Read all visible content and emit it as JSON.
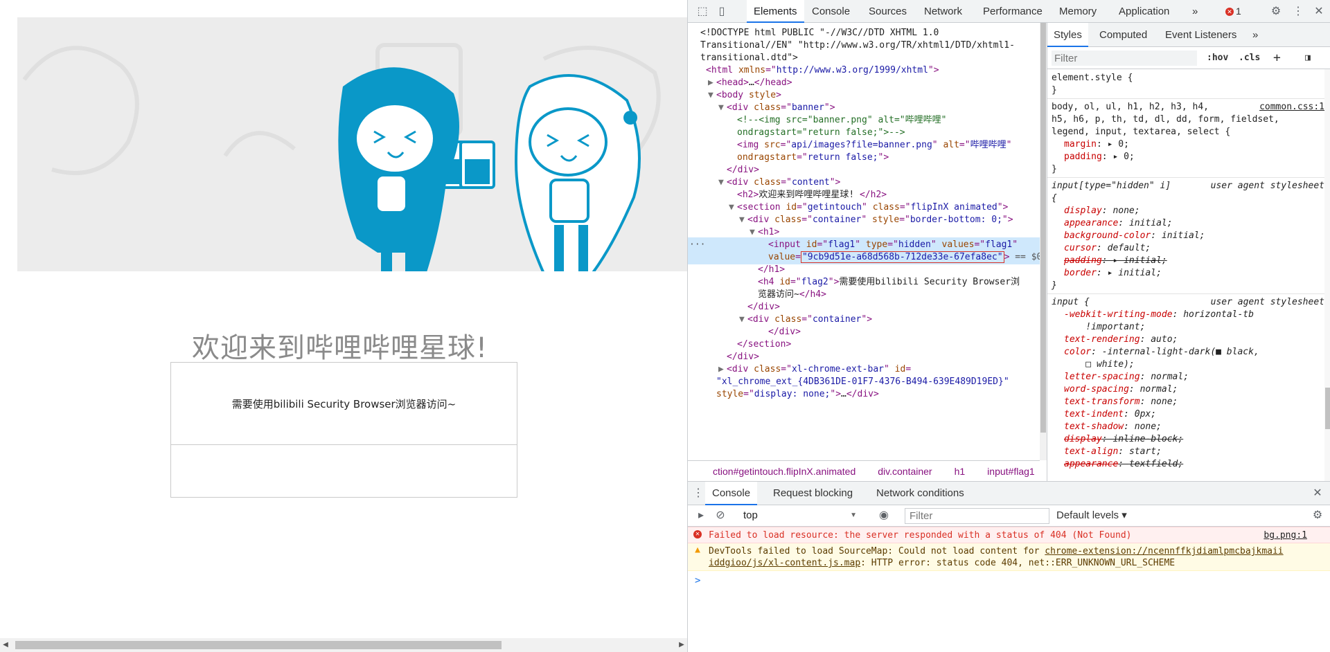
{
  "page": {
    "heading": "欢迎来到哔哩哔哩星球!",
    "message": "需要使用bilibili Security Browser浏览器访问~"
  },
  "devtools": {
    "tabs": [
      "Elements",
      "Console",
      "Sources",
      "Network",
      "Performance",
      "Memory",
      "Application"
    ],
    "more_tabs": "»",
    "error_count": "1",
    "elements": {
      "lines": [
        {
          "id": "l1",
          "parts": [
            [
              "tx",
              "<!DOCTYPE html PUBLIC \"-//W3C//DTD XHTML 1.0"
            ]
          ]
        },
        {
          "id": "l2",
          "parts": [
            [
              "tx",
              "Transitional//EN\" \"http://www.w3.org/TR/xhtml1/DTD/xhtml1-"
            ]
          ]
        },
        {
          "id": "l3",
          "parts": [
            [
              "tx",
              "transitional.dtd\">"
            ]
          ]
        },
        {
          "id": "l4",
          "parts": [
            [
              "tag",
              "<html "
            ],
            [
              "an",
              "xmlns"
            ],
            [
              "tag",
              "=\""
            ],
            [
              "av",
              "http://www.w3.org/1999/xhtml"
            ],
            [
              "tag",
              "\">"
            ]
          ]
        },
        {
          "id": "l5",
          "parts": [
            [
              "tag",
              "<head>"
            ],
            [
              "tx",
              "…"
            ],
            [
              "tag",
              "</head>"
            ]
          ]
        },
        {
          "id": "l6",
          "parts": [
            [
              "tag",
              "<body "
            ],
            [
              "an",
              "style"
            ],
            [
              "tag",
              ">"
            ]
          ]
        },
        {
          "id": "l7",
          "parts": [
            [
              "tag",
              "<div "
            ],
            [
              "an",
              "class"
            ],
            [
              "tag",
              "=\""
            ],
            [
              "av",
              "banner"
            ],
            [
              "tag",
              "\">"
            ]
          ]
        },
        {
          "id": "l8",
          "parts": [
            [
              "cm",
              "<!--<img src=\"banner.png\" alt=\"哔哩哔哩\""
            ]
          ]
        },
        {
          "id": "l9",
          "parts": [
            [
              "cm",
              "ondragstart=\"return false;\">-->"
            ]
          ]
        },
        {
          "id": "l10",
          "parts": [
            [
              "tag",
              "<img "
            ],
            [
              "an",
              "src"
            ],
            [
              "tag",
              "=\""
            ],
            [
              "av",
              "api/images?file=banner.png"
            ],
            [
              "tag",
              "\" "
            ],
            [
              "an",
              "alt"
            ],
            [
              "tag",
              "=\""
            ],
            [
              "av",
              "哔哩哔哩"
            ],
            [
              "tag",
              "\""
            ]
          ]
        },
        {
          "id": "l11",
          "parts": [
            [
              "an",
              "ondragstart"
            ],
            [
              "tag",
              "=\""
            ],
            [
              "av",
              "return false;"
            ],
            [
              "tag",
              "\">"
            ]
          ]
        },
        {
          "id": "l12",
          "parts": [
            [
              "tag",
              "</div>"
            ]
          ]
        },
        {
          "id": "l13",
          "parts": [
            [
              "tag",
              "<div "
            ],
            [
              "an",
              "class"
            ],
            [
              "tag",
              "=\""
            ],
            [
              "av",
              "content"
            ],
            [
              "tag",
              "\">"
            ]
          ]
        },
        {
          "id": "l14",
          "parts": [
            [
              "tag",
              "<h2>"
            ],
            [
              "tx",
              "欢迎来到哔哩哔哩星球! "
            ],
            [
              "tag",
              "</h2>"
            ]
          ]
        },
        {
          "id": "l15",
          "parts": [
            [
              "tag",
              "<section "
            ],
            [
              "an",
              "id"
            ],
            [
              "tag",
              "=\""
            ],
            [
              "av",
              "getintouch"
            ],
            [
              "tag",
              "\" "
            ],
            [
              "an",
              "class"
            ],
            [
              "tag",
              "=\""
            ],
            [
              "av",
              "flipInX animated"
            ],
            [
              "tag",
              "\">"
            ]
          ]
        },
        {
          "id": "l16",
          "parts": [
            [
              "tag",
              "<div "
            ],
            [
              "an",
              "class"
            ],
            [
              "tag",
              "=\""
            ],
            [
              "av",
              "container"
            ],
            [
              "tag",
              "\" "
            ],
            [
              "an",
              "style"
            ],
            [
              "tag",
              "=\""
            ],
            [
              "av",
              "border-bottom: 0;"
            ],
            [
              "tag",
              "\">"
            ]
          ]
        },
        {
          "id": "l17",
          "parts": [
            [
              "tag",
              "<h1>"
            ]
          ]
        },
        {
          "id": "l18",
          "parts": [
            [
              "tag",
              "<input "
            ],
            [
              "an",
              "id"
            ],
            [
              "tag",
              "=\""
            ],
            [
              "av",
              "flag1"
            ],
            [
              "tag",
              "\" "
            ],
            [
              "an",
              "type"
            ],
            [
              "tag",
              "=\""
            ],
            [
              "av",
              "hidden"
            ],
            [
              "tag",
              "\" "
            ],
            [
              "an",
              "values"
            ],
            [
              "tag",
              "=\""
            ],
            [
              "av",
              "flag1"
            ],
            [
              "tag",
              "\""
            ]
          ]
        },
        {
          "id": "l19",
          "parts": [
            [
              "an",
              "value"
            ],
            [
              "tag",
              "="
            ]
          ]
        },
        {
          "id": "l20",
          "parts": [
            [
              "tag",
              "</h1>"
            ]
          ]
        },
        {
          "id": "l21",
          "parts": [
            [
              "tag",
              "<h4 "
            ],
            [
              "an",
              "id"
            ],
            [
              "tag",
              "=\""
            ],
            [
              "av",
              "flag2"
            ],
            [
              "tag",
              "\">"
            ],
            [
              "tx",
              "需要使用bilibili Security Browser浏"
            ]
          ]
        },
        {
          "id": "l22",
          "parts": [
            [
              "tx",
              "览器访问~"
            ],
            [
              "tag",
              "</h4>"
            ]
          ]
        },
        {
          "id": "l23",
          "parts": [
            [
              "tag",
              "</div>"
            ]
          ]
        },
        {
          "id": "l24",
          "parts": [
            [
              "tag",
              "<div "
            ],
            [
              "an",
              "class"
            ],
            [
              "tag",
              "=\""
            ],
            [
              "av",
              "container"
            ],
            [
              "tag",
              "\">"
            ]
          ]
        },
        {
          "id": "l25",
          "parts": [
            [
              "tag",
              "</div>"
            ]
          ]
        },
        {
          "id": "l26",
          "parts": [
            [
              "tag",
              "</section>"
            ]
          ]
        },
        {
          "id": "l27",
          "parts": [
            [
              "tag",
              "</div>"
            ]
          ]
        },
        {
          "id": "l28",
          "parts": [
            [
              "tag",
              "<div "
            ],
            [
              "an",
              "class"
            ],
            [
              "tag",
              "=\""
            ],
            [
              "av",
              "xl-chrome-ext-bar"
            ],
            [
              "tag",
              "\" "
            ],
            [
              "an",
              "id"
            ],
            [
              "tag",
              "="
            ]
          ]
        },
        {
          "id": "l29",
          "parts": [
            [
              "av",
              "\"xl_chrome_ext_{4DB361DE-01F7-4376-B494-639E489D19ED}\""
            ]
          ]
        },
        {
          "id": "l30",
          "parts": [
            [
              "an",
              "style"
            ],
            [
              "tag",
              "=\""
            ],
            [
              "av",
              "display: none;"
            ],
            [
              "tag",
              "\">"
            ],
            [
              "tx",
              "…"
            ],
            [
              "tag",
              "</div>"
            ]
          ]
        }
      ],
      "flag_value": "\"9cb9d51e-a68d568b-712de33e-67efa8ec\"",
      "selected_suffix": " == $0",
      "dots": "···",
      "breadcrumb": [
        "ction#getintouch.flipInX.animated",
        "div.container",
        "h1",
        "input#flag1"
      ],
      "breadcrumb_more": "···"
    },
    "styles": {
      "tabs": [
        "Styles",
        "Computed",
        "Event Listeners"
      ],
      "more": "»",
      "filter_placeholder": "Filter",
      "hov": ":hov",
      "cls": ".cls",
      "plus": "+",
      "rules": [
        {
          "id": "r0",
          "text": "element.style {"
        },
        {
          "id": "r0e",
          "text": "}"
        },
        {
          "id": "r1a",
          "text": "body, ol, ul, h1, h2, h3, h4,",
          "src": "common.css:1"
        },
        {
          "id": "r1b",
          "text": "h5, h6, p, th, td, dl, dd, form, fieldset,"
        },
        {
          "id": "r1c",
          "text": "legend, input, textarea, select {"
        },
        {
          "id": "r1d",
          "prop": "margin",
          "val": "▸ 0;"
        },
        {
          "id": "r1e",
          "prop": "padding",
          "val": "▸ 0;"
        },
        {
          "id": "r1f",
          "text": "}"
        },
        {
          "id": "r2a",
          "text": "input[type=\"hidden\" i]",
          "src": "user agent stylesheet"
        },
        {
          "id": "r2b",
          "text": "{"
        },
        {
          "id": "r2c",
          "prop": "display",
          "val": "none;"
        },
        {
          "id": "r2d",
          "prop": "appearance",
          "val": "initial;"
        },
        {
          "id": "r2e",
          "prop": "background-color",
          "val": "initial;"
        },
        {
          "id": "r2f",
          "prop": "cursor",
          "val": "default;"
        },
        {
          "id": "r2g",
          "prop": "padding",
          "val": "▸ initial;",
          "strike": true
        },
        {
          "id": "r2h",
          "prop": "border",
          "val": "▸ initial;"
        },
        {
          "id": "r2i",
          "text": "}"
        },
        {
          "id": "r3a",
          "text": "input {",
          "src": "user agent stylesheet"
        },
        {
          "id": "r3b",
          "prop": "-webkit-writing-mode",
          "val": "horizontal-tb"
        },
        {
          "id": "r3c",
          "text": "    !important;"
        },
        {
          "id": "r3d",
          "prop": "text-rendering",
          "val": "auto;"
        },
        {
          "id": "r3e",
          "prop": "color",
          "val": "-internal-light-dark(■ black,"
        },
        {
          "id": "r3f",
          "text": "    □ white);"
        },
        {
          "id": "r3g",
          "prop": "letter-spacing",
          "val": "normal;"
        },
        {
          "id": "r3h",
          "prop": "word-spacing",
          "val": "normal;"
        },
        {
          "id": "r3i",
          "prop": "text-transform",
          "val": "none;"
        },
        {
          "id": "r3j",
          "prop": "text-indent",
          "val": "0px;"
        },
        {
          "id": "r3k",
          "prop": "text-shadow",
          "val": "none;"
        },
        {
          "id": "r3l",
          "prop": "display",
          "val": "inline-block;",
          "strike": true
        },
        {
          "id": "r3m",
          "prop": "text-align",
          "val": "start;"
        },
        {
          "id": "r3n",
          "prop": "appearance",
          "val": "textfield;",
          "strike": true
        }
      ]
    },
    "drawer": {
      "tabs": [
        "Console",
        "Request blocking",
        "Network conditions"
      ],
      "context": "top",
      "filter_placeholder": "Filter",
      "levels": "Default levels ▾",
      "error_msg": "Failed to load resource: the server responded with a status of 404 (Not Found)",
      "error_src": "bg.png:1",
      "warn_line1_a": "DevTools failed to load SourceMap: Could not load content for ",
      "warn_line1_b": "chrome-extension://ncennffkjdiamlpmcbajkmaii",
      "warn_line2_a": "iddgioo/js/xl-content.js.map",
      "warn_line2_b": ": HTTP error: status code 404, net::ERR_UNKNOWN_URL_SCHEME",
      "prompt": ">"
    }
  }
}
